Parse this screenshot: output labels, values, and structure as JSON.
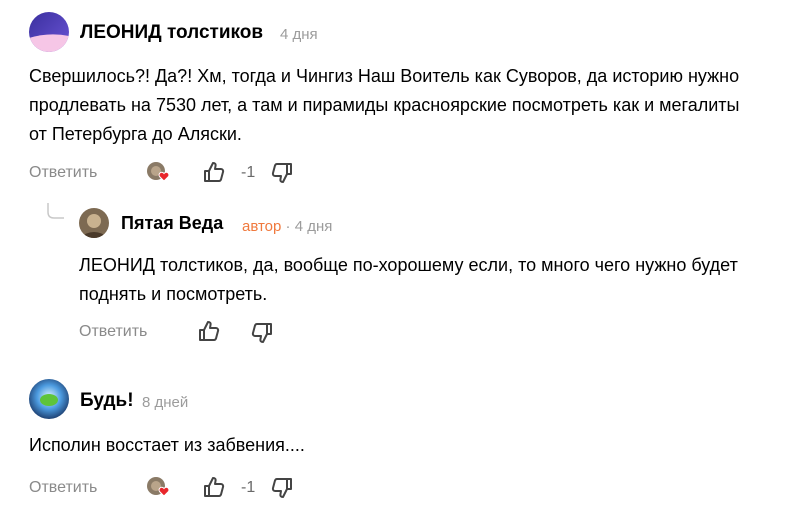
{
  "comments": [
    {
      "author": "ЛЕОНИД толстиков",
      "time": "4 дня",
      "text": "Свершилось?! Да?! Хм, тогда и Чингиз Наш Воитель как Суворов, да историю нужно продлевать на 7530 лет, а там и пирамиды красноярские посмотреть как и мегалиты от Петербурга до Аляски.",
      "reply_label": "Ответить",
      "vote_count": "-1",
      "reply": {
        "author": "Пятая Веда",
        "badge": "автор",
        "separator": "·",
        "time": "4 дня",
        "text": "ЛЕОНИД толстиков, да, вообще по-хорошему если, то много чего нужно будет поднять и посмотреть.",
        "reply_label": "Ответить"
      }
    },
    {
      "author": "Будь!",
      "time": "8 дней",
      "text": "Исполин восстает из забвения....",
      "reply_label": "Ответить",
      "vote_count": "-1"
    }
  ],
  "colors": {
    "author_badge": "#f0793d",
    "meta_gray": "#9c9c9c",
    "heart": "#e8262b"
  },
  "icons": [
    "avatar-leonid",
    "liked-by-author-icon",
    "thumbs-up-icon",
    "thumbs-down-icon",
    "thread-line-icon"
  ]
}
